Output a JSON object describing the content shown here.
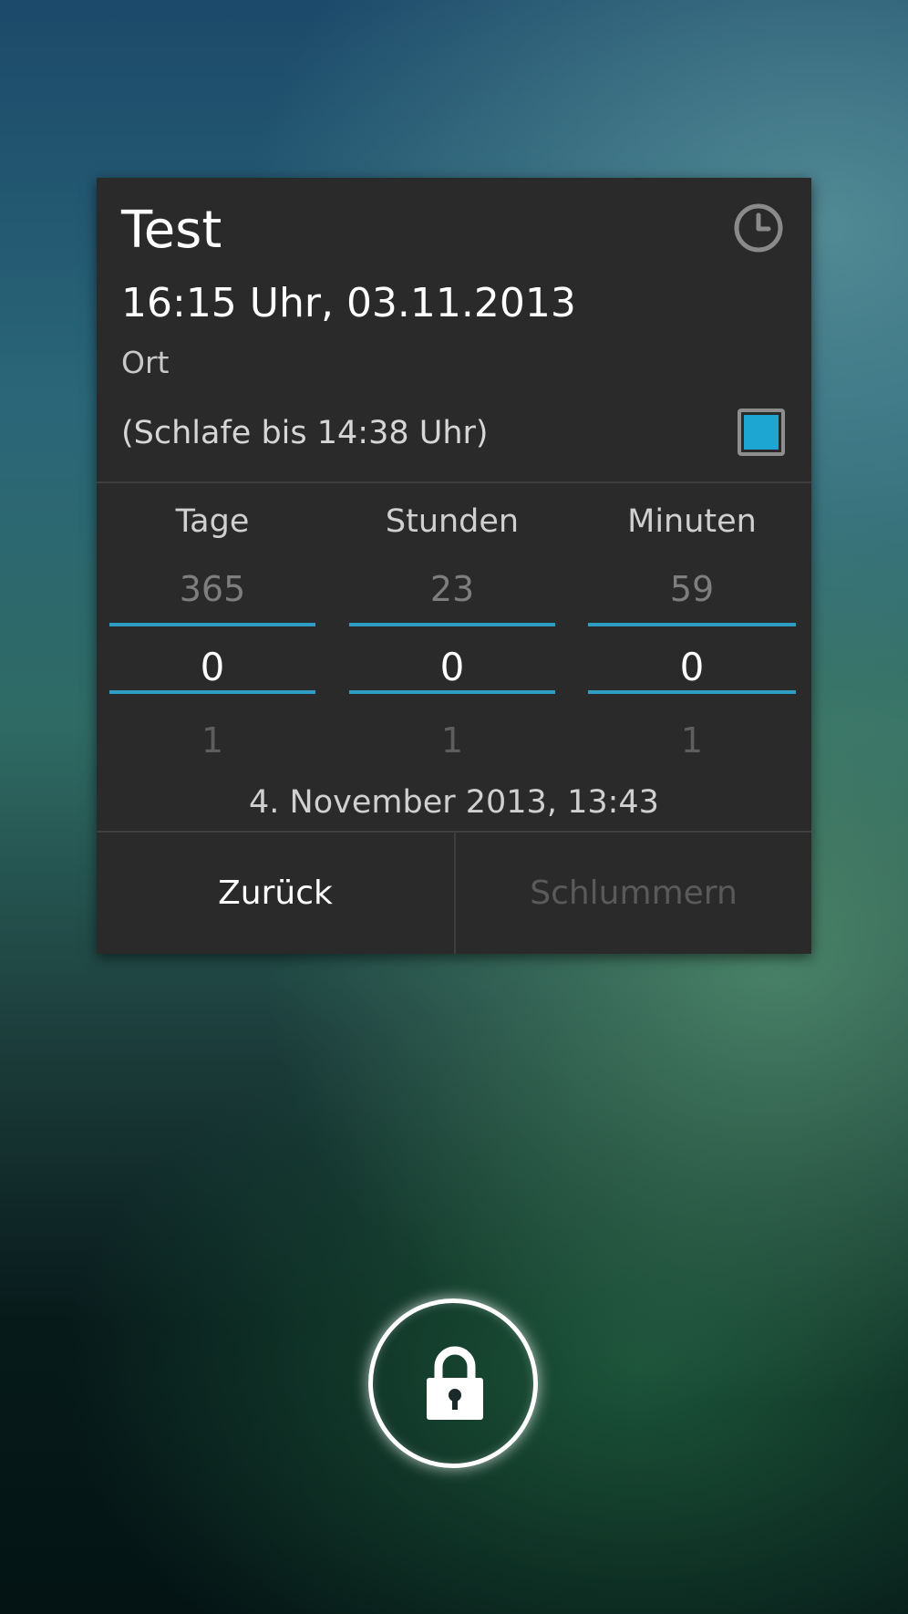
{
  "card": {
    "title": "Test",
    "datetime": "16:15 Uhr, 03.11.2013",
    "location": "Ort",
    "snooze_info": "(Schlafe bis 14:38 Uhr)",
    "checkbox_checked": true,
    "accent_color": "#1ea6d2"
  },
  "picker": {
    "days": {
      "label": "Tage",
      "prev": "365",
      "current": "0",
      "next": "1"
    },
    "hours": {
      "label": "Stunden",
      "prev": "23",
      "current": "0",
      "next": "1"
    },
    "minutes": {
      "label": "Minuten",
      "prev": "59",
      "current": "0",
      "next": "1"
    }
  },
  "result_date": "4. November 2013, 13:43",
  "buttons": {
    "back": "Zurück",
    "snooze": "Schlummern"
  },
  "icons": {
    "clock": "clock-icon",
    "lock": "lock-icon"
  }
}
